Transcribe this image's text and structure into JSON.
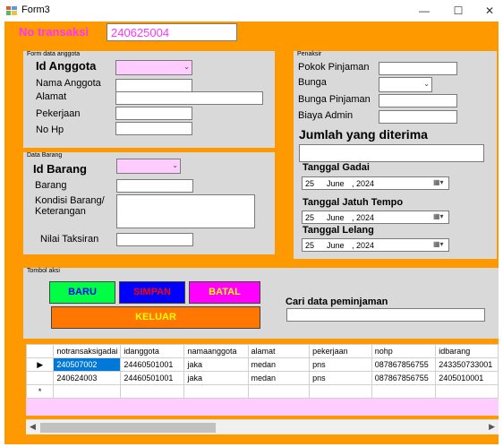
{
  "window": {
    "title": "Form3",
    "minimize": "—",
    "maximize": "☐",
    "close": "✕"
  },
  "header": {
    "no_transaksi_label": "No transaksi",
    "no_transaksi_value": "240625004"
  },
  "anggota": {
    "group_title": "Form data anggota",
    "id_label": "Id Anggota",
    "nama_label": "Nama Anggota",
    "alamat_label": "Alamat",
    "pekerjaan_label": "Pekerjaan",
    "nohp_label": "No Hp"
  },
  "barang": {
    "group_title": "Data Barang",
    "id_label": "Id Barang",
    "barang_label": "Barang",
    "kondisi_label_1": "Kondisi Barang/",
    "kondisi_label_2": "Keterangan",
    "nilai_label": "Nilai Taksiran"
  },
  "penaksir": {
    "group_title": "Penaksir",
    "pokok_label": "Pokok Pinjaman",
    "bunga_label": "Bunga",
    "bunga_pinjaman_label": "Bunga Pinjaman",
    "biaya_admin_label": "Biaya Admin",
    "jumlah_label": "Jumlah yang diterima",
    "tgl_gadai_label": "Tanggal Gadai",
    "tgl_jatuh_label": "Tanggal Jatuh Tempo",
    "tgl_lelang_label": "Tanggal Lelang",
    "date_day": "25",
    "date_month": "June",
    "date_year": ", 2024"
  },
  "aksi": {
    "group_title": "Tombol aksi",
    "baru": "BARU",
    "simpan": "SIMPAN",
    "batal": "BATAL",
    "keluar": "KELUAR",
    "cari_label": "Cari data peminjaman"
  },
  "grid": {
    "columns": [
      "notransaksigadai",
      "idanggota",
      "namaanggota",
      "alamat",
      "pekerjaan",
      "nohp",
      "idbarang"
    ],
    "rows": [
      [
        "240507002",
        "24460501001",
        "jaka",
        "medan",
        "pns",
        "087867856755",
        "243350733001"
      ],
      [
        "240624003",
        "24460501001",
        "jaka",
        "medan",
        "pns",
        "087867856755",
        "2405010001"
      ]
    ],
    "current_row_marker": "▶",
    "new_row_marker": "*"
  },
  "colors": {
    "form_bg": "#ff9900",
    "group_bg": "#d9d9d9",
    "accent_text": "#ff33ff",
    "baru_bg": "#00ff44",
    "simpan_bg": "#0000ff",
    "batal_bg": "#ff00ff",
    "keluar_bg": "#ff7700",
    "selection": "#0078d7"
  }
}
